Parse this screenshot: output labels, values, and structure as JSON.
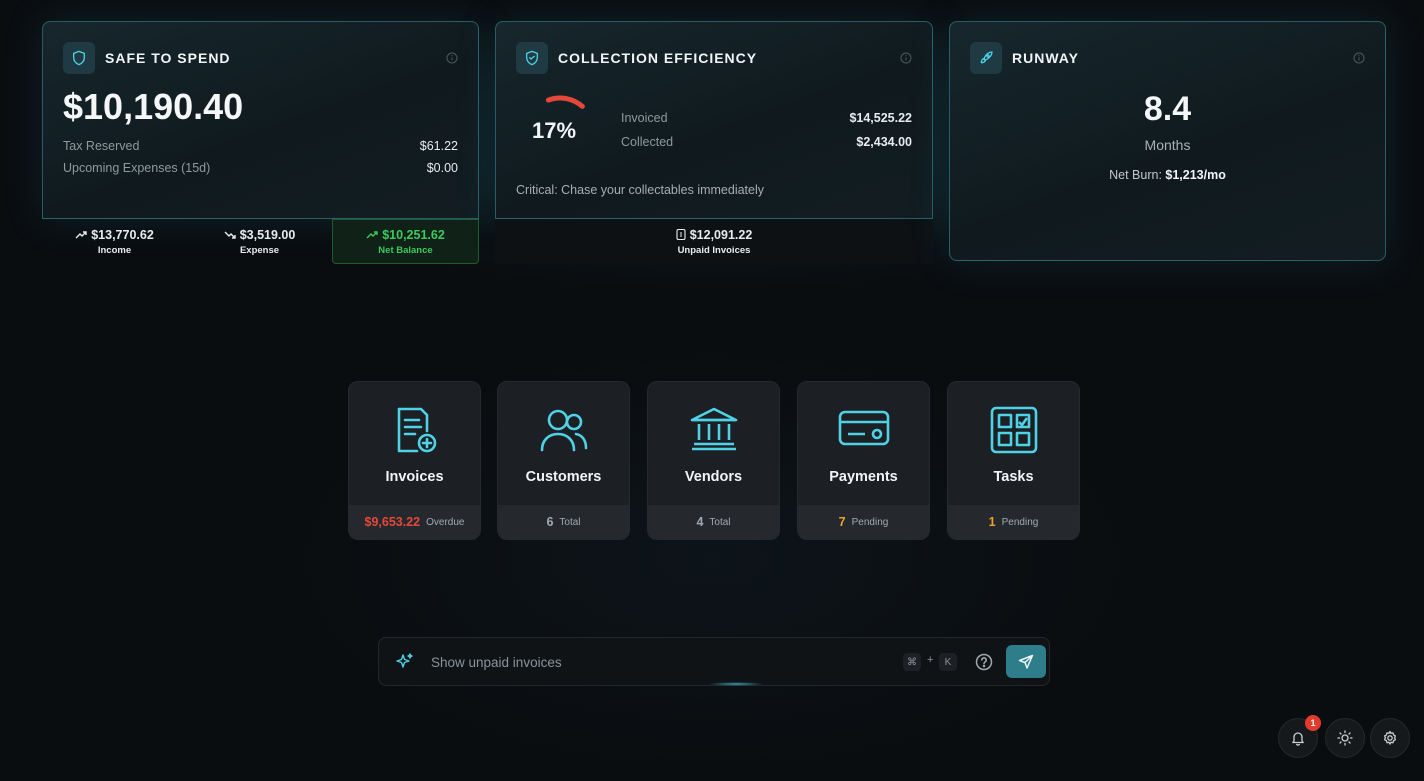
{
  "colors": {
    "accent": "#4fd1e6",
    "danger": "#e5483a",
    "warning": "#f0a030",
    "positive": "#3ec85e"
  },
  "safe_to_spend": {
    "title": "SAFE TO SPEND",
    "icon": "shield-icon",
    "amount": "$10,190.40",
    "tax_reserved_label": "Tax Reserved",
    "tax_reserved_value": "$61.22",
    "upcoming_label": "Upcoming Expenses (15d)",
    "upcoming_value": "$0.00",
    "income_value": "$13,770.62",
    "income_label": "Income",
    "expense_value": "$3,519.00",
    "expense_label": "Expense",
    "net_value": "$10,251.62",
    "net_label": "Net Balance"
  },
  "collection": {
    "title": "COLLECTION EFFICIENCY",
    "icon": "handshake-shield-icon",
    "percent": "17%",
    "percent_value": 0.17,
    "invoiced_label": "Invoiced",
    "invoiced_value": "$14,525.22",
    "collected_label": "Collected",
    "collected_value": "$2,434.00",
    "critical_text": "Critical: Chase your collectables immediately",
    "unpaid_value": "$12,091.22",
    "unpaid_label": "Unpaid Invoices"
  },
  "runway": {
    "title": "RUNWAY",
    "icon": "rocket-icon",
    "value": "8.4",
    "unit": "Months",
    "burn_label": "Net Burn:",
    "burn_value": "$1,213/mo"
  },
  "tiles": [
    {
      "label": "Invoices",
      "icon": "invoice-icon",
      "count": "$9,653.22",
      "sub": "Overdue",
      "count_color": "#e5483a"
    },
    {
      "label": "Customers",
      "icon": "users-icon",
      "count": "6",
      "sub": "Total",
      "count_color": "#a2aab0"
    },
    {
      "label": "Vendors",
      "icon": "bank-icon",
      "count": "4",
      "sub": "Total",
      "count_color": "#a2aab0"
    },
    {
      "label": "Payments",
      "icon": "credit-card-icon",
      "count": "7",
      "sub": "Pending",
      "count_color": "#f0a030"
    },
    {
      "label": "Tasks",
      "icon": "tasks-grid-icon",
      "count": "1",
      "sub": "Pending",
      "count_color": "#f0a030"
    }
  ],
  "command_bar": {
    "placeholder": "Show unpaid invoices",
    "shortcut_key1": "⌘",
    "shortcut_plus": "+",
    "shortcut_key2": "K"
  },
  "notifications": {
    "count": "1"
  }
}
